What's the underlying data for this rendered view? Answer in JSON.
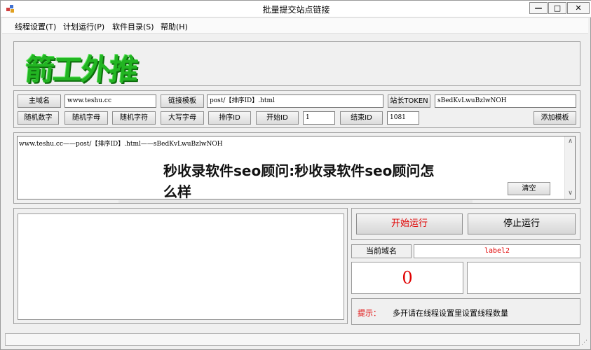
{
  "window": {
    "title": "批量提交站点链接",
    "min": "—",
    "max": "□",
    "close": "✕"
  },
  "menu": [
    {
      "label": "线程设置(T)"
    },
    {
      "label": "计划运行(P)"
    },
    {
      "label": "软件目录(S)"
    },
    {
      "label": "帮助(H)"
    }
  ],
  "logo": {
    "text": "箭工外推"
  },
  "row1": {
    "main_domain_btn": "主域名",
    "main_domain_value": "www.teshu.cc",
    "link_template_btn": "链接模板",
    "link_template_value": "post/【排序ID】.html",
    "token_btn": "站长TOKEN",
    "token_value": "sBedKvLwuBzlwNOH"
  },
  "row2": {
    "random_digits": "随机数字",
    "random_letters": "随机字母",
    "random_chars": "随机字符",
    "uppercase": "大写字母",
    "sort_id": "排序ID",
    "start_id_btn": "开始ID",
    "start_id_value": "1",
    "end_id_btn": "结束ID",
    "end_id_value": "1081",
    "add_template": "添加模板"
  },
  "template_list": {
    "line": "www.teshu.cc——post/【排序ID】.html——sBedKvLwuBzlwNOH",
    "clear_btn": "清空"
  },
  "overlay": {
    "text": "秒收录软件seo顾问:秒收录软件seo顾问怎么样"
  },
  "controls": {
    "start": "开始运行",
    "stop": "停止运行",
    "current_domain_label": "当前域名",
    "current_domain_value": "label2",
    "count": "0",
    "hint_label": "提示：",
    "hint_text": "多开请在线程设置里设置线程数量"
  },
  "colors": {
    "start_text": "#e00000",
    "count": "#e00000",
    "logo": "#22b522"
  }
}
